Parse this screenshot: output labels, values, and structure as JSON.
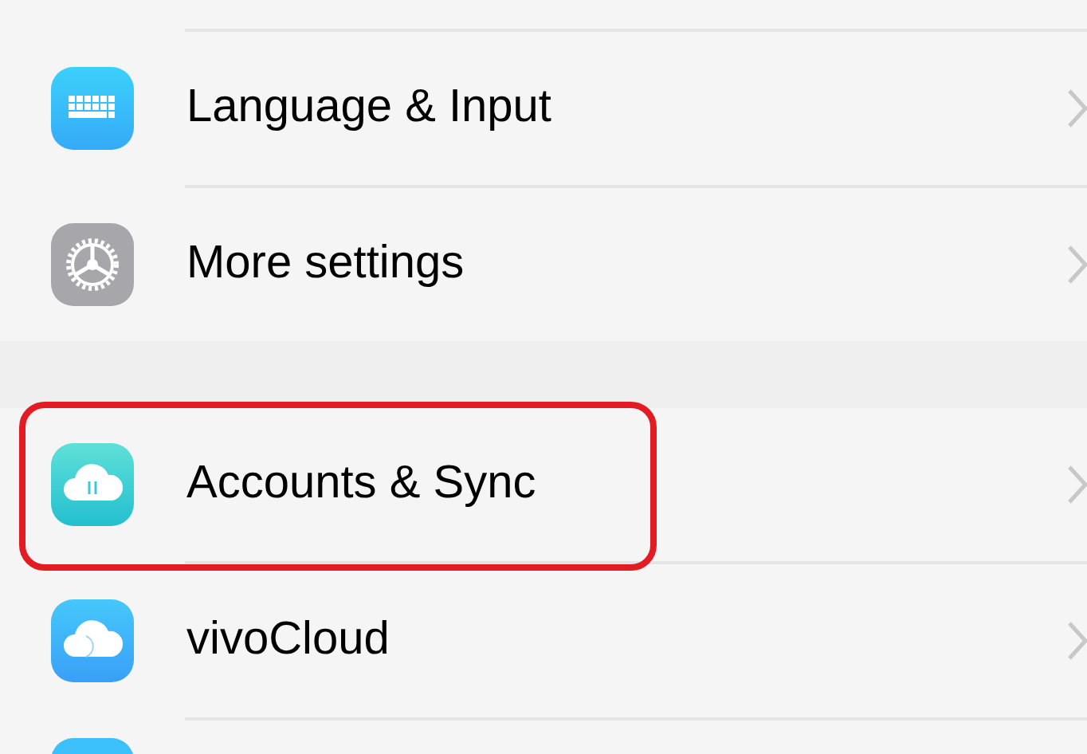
{
  "groups": [
    {
      "items": [
        {
          "kind": "keyboard",
          "label": "Language & Input",
          "highlighted": false
        },
        {
          "kind": "gear",
          "label": "More settings",
          "highlighted": false
        }
      ]
    },
    {
      "items": [
        {
          "kind": "cloud-sync",
          "label": "Accounts & Sync",
          "highlighted": true
        },
        {
          "kind": "cloud",
          "label": "vivoCloud",
          "highlighted": false
        },
        {
          "kind": "partial"
        }
      ]
    }
  ]
}
